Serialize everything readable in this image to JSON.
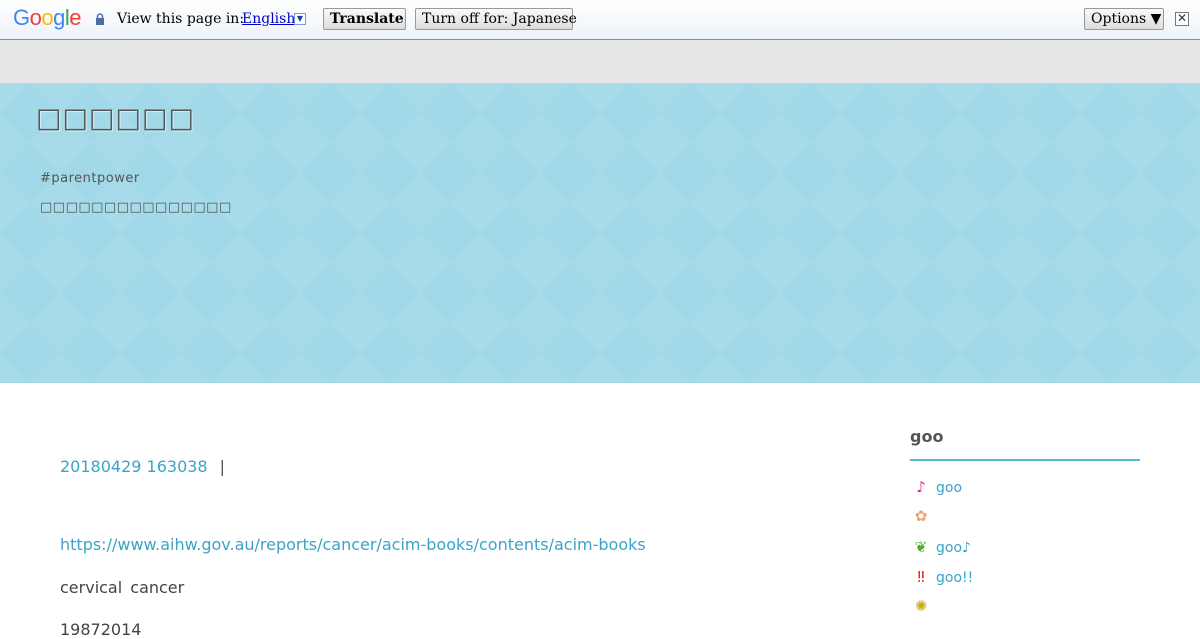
{
  "translate_bar": {
    "logo": "Google",
    "view_text": "View this page in:",
    "language": "English",
    "translate_label": "Translate",
    "turn_off_label": "Turn off for: Japanese",
    "options_label": "Options ▼",
    "close_glyph": "✕"
  },
  "header": {
    "blog_title": "□□□□□□",
    "hashtag": "#parentpower",
    "description": "□□□□□□□□□□□□□□□"
  },
  "post": {
    "date": "20180429 163038",
    "separator": "|",
    "link": "https://www.aihw.gov.au/reports/cancer/acim-books/contents/acim-books",
    "text1": "cervical  cancer",
    "text2": "19872014"
  },
  "sidebar": {
    "title": "goo",
    "items": [
      {
        "icon": "music-note-icon",
        "glyph": "♪",
        "color": "#d4388a",
        "label": "goo"
      },
      {
        "icon": "flower-icon",
        "glyph": "✿",
        "color": "#f0a070",
        "label": ""
      },
      {
        "icon": "sprout-icon",
        "glyph": "❦",
        "color": "#4caf30",
        "label": "goo♪"
      },
      {
        "icon": "double-exclamation-icon",
        "glyph": "‼",
        "color": "#e02020",
        "label": "goo!!"
      },
      {
        "icon": "lightbulb-icon",
        "glyph": "✺",
        "color": "#c8b020",
        "label": ""
      }
    ]
  },
  "colors": {
    "header_bg": "#a2d9e9",
    "link": "#3aa3c8",
    "accent_line": "#57b8d4"
  }
}
